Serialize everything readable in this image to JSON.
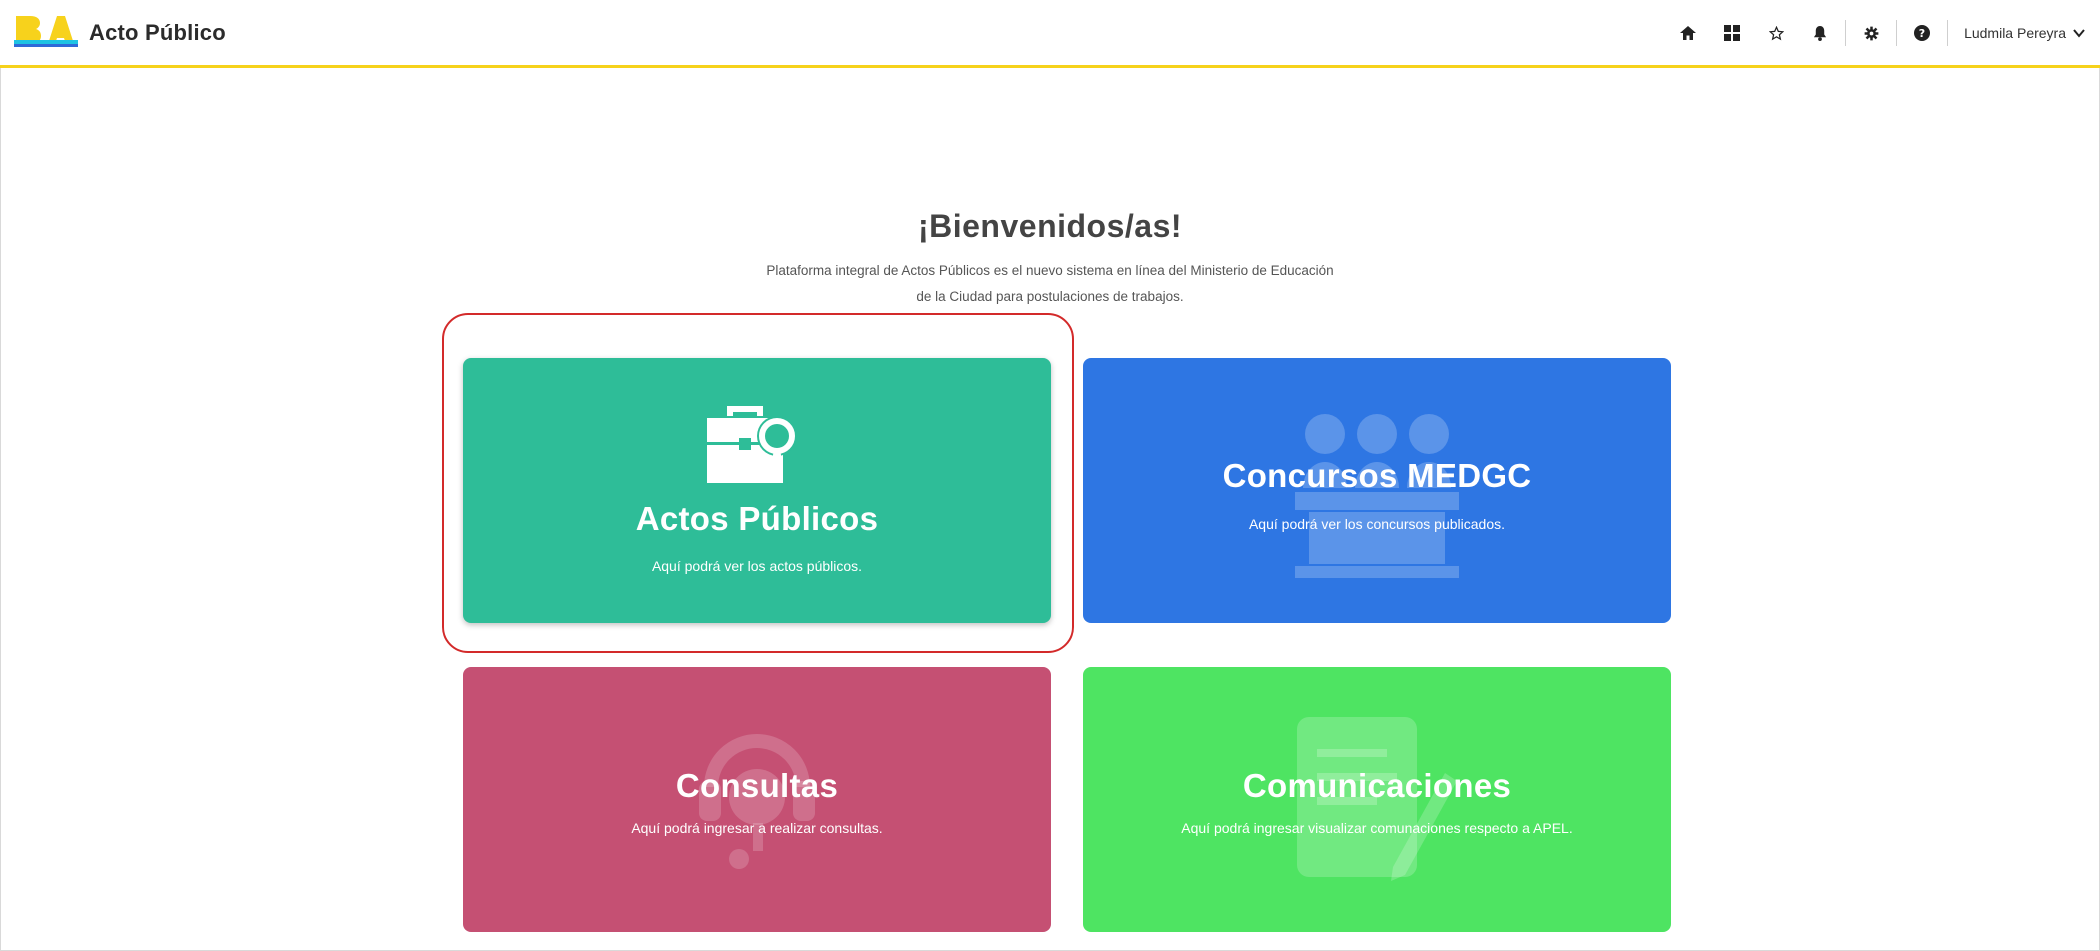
{
  "header": {
    "app_title": "Acto Público",
    "user_name": "Ludmila Pereyra",
    "icons": [
      "home-icon",
      "grid-icon",
      "star-icon",
      "bell-icon",
      "gear-icon",
      "help-icon"
    ],
    "accent_color": "#f6d21b"
  },
  "main": {
    "welcome": "¡Bienvenidos/as!",
    "intro_line1": "Plataforma integral de Actos Públicos es el nuevo sistema en línea del Ministerio de Educación",
    "intro_line2": "de la Ciudad para postulaciones de trabajos."
  },
  "cards": {
    "actos": {
      "title": "Actos Públicos",
      "desc": "Aquí podrá ver los actos públicos.",
      "color": "#2ebd98",
      "icon": "briefcase-search-icon"
    },
    "concursos": {
      "title": "Concursos MEDGC",
      "desc": "Aquí podrá ver los concursos publicados.",
      "color": "#2e76e3",
      "icon": "people-panel-icon"
    },
    "consultas": {
      "title": "Consultas",
      "desc": "Aquí podrá ingresar a realizar consultas.",
      "color": "#c55073",
      "icon": "headset-icon"
    },
    "comunicaciones": {
      "title": "Comunicaciones",
      "desc": "Aquí podrá ingresar visualizar comunaciones respecto a APEL.",
      "color": "#4ee462",
      "icon": "document-pen-icon"
    }
  }
}
